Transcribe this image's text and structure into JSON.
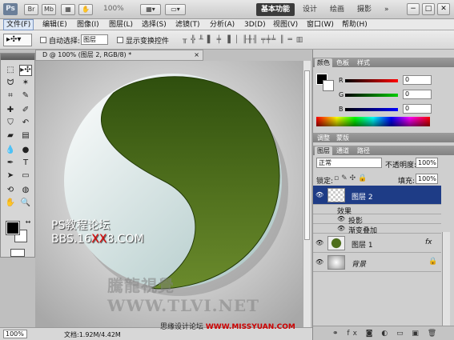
{
  "appbar": {
    "logo": "Ps",
    "br_label": "Br",
    "mb_label": "Mb",
    "zoom": "100%",
    "workspaces": [
      "基本功能",
      "设计",
      "绘画",
      "摄影"
    ],
    "more": "»"
  },
  "menubar": [
    "文件(F)",
    "编辑(E)",
    "图像(I)",
    "图层(L)",
    "选择(S)",
    "滤镜(T)",
    "分析(A)",
    "3D(D)",
    "视图(V)",
    "窗口(W)",
    "帮助(H)"
  ],
  "options": {
    "auto_select_label": "自动选择:",
    "auto_select_value": "图层",
    "show_transform_label": "显示变换控件"
  },
  "document": {
    "tab_title": "D @ 100% (图层 2, RGB/8) *",
    "zoom": "100%",
    "doc_size": "文档:1.92M/4.42M",
    "watermark_top_a": "PS教程论坛",
    "watermark_top_b": "BBS.16",
    "watermark_top_xx": "XX",
    "watermark_top_c": "8.COM",
    "watermark_bottom": "騰龍視覺 WWW.TLVI.NET"
  },
  "color_panel": {
    "tabs": [
      "颜色",
      "色板",
      "样式"
    ],
    "channels": [
      {
        "label": "R",
        "value": "0",
        "color": "#d00000"
      },
      {
        "label": "G",
        "value": "0",
        "color": "#00b000"
      },
      {
        "label": "B",
        "value": "0",
        "color": "#0000d0"
      }
    ]
  },
  "adjust_tabs": [
    "调整",
    "蒙版"
  ],
  "layers_panel": {
    "tabs": [
      "图层",
      "通道",
      "路径"
    ],
    "blend_mode": "正常",
    "opacity_label": "不透明度:",
    "opacity": "100%",
    "lock_label": "锁定:",
    "fill_label": "填充:",
    "fill": "100%",
    "layers": [
      {
        "name": "图层 2",
        "selected": true
      },
      {
        "name": "效果",
        "selected": false
      },
      {
        "name": "投影",
        "selected": false
      },
      {
        "name": "渐变叠加",
        "selected": false
      },
      {
        "name": "图层 1",
        "selected": false
      },
      {
        "name": "背景",
        "selected": false
      }
    ],
    "fx_label": "fx",
    "footer_icons": "⚭ fx ◙ ◐ ▭ ▣ 🗑"
  },
  "credit": {
    "text_a": "思缘设计论坛 ",
    "text_b": "WWW.MISSYUAN.COM"
  },
  "colors": {
    "yin_green": "#4e6e1c",
    "yin_white": "#f2f6f4",
    "selected_layer": "#1e3c86"
  }
}
